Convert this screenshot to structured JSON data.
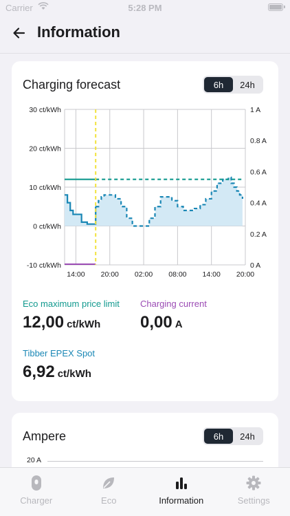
{
  "status_bar": {
    "carrier": "Carrier",
    "time": "5:28 PM"
  },
  "header": {
    "title": "Information"
  },
  "forecast_card": {
    "title": "Charging forecast",
    "range_options": [
      "6h",
      "24h"
    ],
    "selected_range": "6h",
    "chart_data": {
      "type": "line",
      "title": "Charging forecast",
      "x_tick_labels": [
        "14:00",
        "20:00",
        "02:00",
        "08:00",
        "14:00",
        "20:00"
      ],
      "y_left_ticks": [
        "30 ct/kWh",
        "20 ct/kWh",
        "10 ct/kWh",
        "0 ct/kWh",
        "-10 ct/kWh"
      ],
      "y_right_ticks": [
        "1 A",
        "0.8 A",
        "0.6 A",
        "0.4 A",
        "0.2 A",
        "0 A"
      ],
      "ylim_left": [
        -10,
        30
      ],
      "ylim_right": [
        0,
        1
      ],
      "now_hours": 17.5,
      "series": [
        {
          "name": "Tibber EPEX Spot",
          "color": "#1a87b5",
          "style": "step-area",
          "x_hours": [
            12,
            12.5,
            13,
            13.5,
            14,
            15,
            16,
            17,
            17.5,
            18,
            18.5,
            19,
            20,
            21,
            22,
            23,
            24,
            25,
            26,
            27,
            28,
            29,
            30,
            31,
            32,
            33,
            34,
            35,
            36,
            37,
            38,
            39,
            40,
            41,
            41.5,
            42,
            42.5,
            43,
            43.5
          ],
          "values": [
            8,
            6,
            4,
            3,
            3,
            1,
            0.5,
            0.5,
            5,
            6.5,
            7.5,
            8,
            8,
            7,
            5,
            2,
            0,
            0,
            0,
            2,
            5,
            7.5,
            7.5,
            6.5,
            5,
            4,
            4,
            4.5,
            5.5,
            7,
            9,
            11,
            12,
            12.5,
            11,
            10,
            9,
            8,
            7
          ]
        },
        {
          "name": "Eco maximum price limit",
          "color": "#11998e",
          "style": "line",
          "x_hours": [
            12,
            17.5,
            43.5
          ],
          "values": [
            12,
            12,
            12
          ]
        },
        {
          "name": "Charging current",
          "color": "#9b4bb4",
          "style": "line",
          "axis": "right",
          "x_hours": [
            12,
            17.5
          ],
          "values": [
            0,
            0
          ]
        }
      ]
    },
    "stats": {
      "eco_limit": {
        "label": "Eco maximum price limit",
        "value": "12,00",
        "unit": "ct/kWh",
        "color": "#11998e"
      },
      "charging_current": {
        "label": "Charging current",
        "value": "0,00",
        "unit": "A",
        "color": "#9b4bb4"
      },
      "spot": {
        "label": "Tibber EPEX Spot",
        "value": "6,92",
        "unit": "ct/kWh",
        "color": "#1a87b5"
      }
    }
  },
  "ampere_card": {
    "title": "Ampere",
    "range_options": [
      "6h",
      "24h"
    ],
    "selected_range": "6h",
    "y_tick_label": "20 A"
  },
  "tabbar": {
    "tabs": [
      {
        "label": "Charger",
        "icon": "charger-icon"
      },
      {
        "label": "Eco",
        "icon": "leaf-icon"
      },
      {
        "label": "Information",
        "icon": "bar-chart-icon"
      },
      {
        "label": "Settings",
        "icon": "gear-icon"
      }
    ],
    "active": "Information"
  }
}
